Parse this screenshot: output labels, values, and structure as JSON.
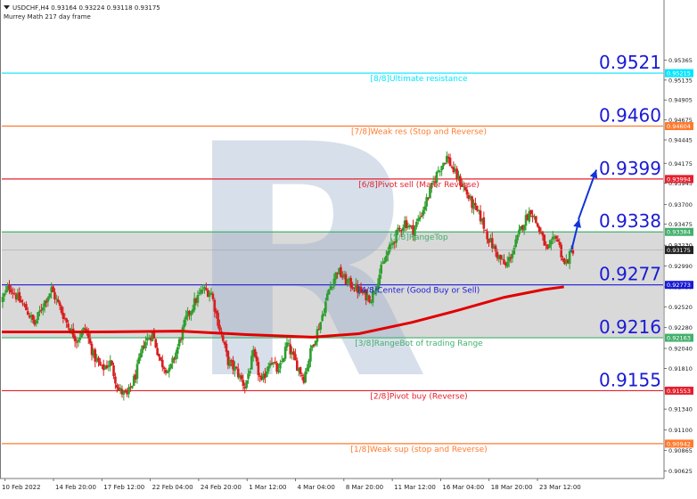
{
  "header": {
    "symbol_line": "USDCHF,H4  0.93164 0.93224 0.93118 0.93175",
    "indicator_line": "Murrey Math 217 day frame"
  },
  "watermark": "R",
  "colors": {
    "background": "#ffffff",
    "candle_bull": "#2e9e2e",
    "candle_bear": "#d81e1e",
    "moving_average": "#e10000",
    "trend_arrow": "#1234d8",
    "range_band": "#d5d5d5"
  },
  "chart_data": {
    "type": "candlestick",
    "symbol": "USDCHF",
    "timeframe": "H4",
    "current_price": 0.93175,
    "y_range": [
      0.9054,
      0.9575
    ],
    "y_ticks": [
      "0.95365",
      "0.95135",
      "0.94905",
      "0.94675",
      "0.94445",
      "0.94175",
      "0.93945",
      "0.93700",
      "0.93475",
      "0.93230",
      "0.92990",
      "0.92750",
      "0.92520",
      "0.92280",
      "0.92040",
      "0.91810",
      "0.91580",
      "0.91340",
      "0.91100",
      "0.90865",
      "0.90625"
    ],
    "x_labels": [
      "10 Feb 2022",
      "14 Feb 20:00",
      "17 Feb 12:00",
      "22 Feb 04:00",
      "24 Feb 20:00",
      "1 Mar 12:00",
      "4 Mar 04:00",
      "8 Mar 20:00",
      "11 Mar 12:00",
      "16 Mar 04:00",
      "18 Mar 20:00",
      "23 Mar 12:00"
    ],
    "current_price_label": "0.93175",
    "levels": [
      {
        "id": "ultimate-resistance",
        "label": "[8/8]Ultimate resistance",
        "price": 0.95215,
        "price_label": "0.95215",
        "big_label": "0.9521",
        "color": "#00e5ff"
      },
      {
        "id": "weak-res",
        "label": "[7/8]Weak res (Stop and Reverse)",
        "price": 0.94604,
        "price_label": "0.94604",
        "big_label": "0.9460",
        "color": "#ff7a2e"
      },
      {
        "id": "pivot-sell",
        "label": "[6/8]Pivot sell (Major Reverse)",
        "price": 0.93994,
        "price_label": "0.93994",
        "big_label": "0.9399",
        "color": "#e4202e"
      },
      {
        "id": "range-top",
        "label": "[5/8]RangeTop",
        "price": 0.93384,
        "price_label": "0.93384",
        "big_label": "0.9338",
        "color": "#43b06c"
      },
      {
        "id": "center",
        "label": "[4/8]Center (Good Buy or Sell)",
        "price": 0.92773,
        "price_label": "0.92773",
        "big_label": "0.9277",
        "color": "#1a1ad6"
      },
      {
        "id": "range-bot",
        "label": "[3/8]RangeBot of trading Range",
        "price": 0.92163,
        "price_label": "0.92163",
        "big_label": "0.9216",
        "color": "#43b06c"
      },
      {
        "id": "pivot-buy",
        "label": "[2/8]Pivot buy (Reverse)",
        "price": 0.91553,
        "price_label": "0.91553",
        "big_label": "0.9155",
        "color": "#e4202e"
      },
      {
        "id": "weak-sup",
        "label": "[1/8]Weak sup (stop and Reverse)",
        "price": 0.90942,
        "price_label": "0.90942",
        "big_label": "",
        "color": "#ff7a2e"
      }
    ],
    "range_band": [
      0.92163,
      0.93384
    ],
    "close_path": [
      0.9258,
      0.9276,
      0.9262,
      0.9249,
      0.9232,
      0.9255,
      0.9272,
      0.9251,
      0.923,
      0.9214,
      0.9227,
      0.9196,
      0.918,
      0.9188,
      0.9156,
      0.9149,
      0.9173,
      0.921,
      0.9221,
      0.9188,
      0.9177,
      0.9205,
      0.9238,
      0.9257,
      0.9272,
      0.9268,
      0.9227,
      0.9189,
      0.9178,
      0.916,
      0.9197,
      0.9163,
      0.9192,
      0.9176,
      0.9209,
      0.9188,
      0.917,
      0.9207,
      0.9235,
      0.9272,
      0.9294,
      0.9282,
      0.9275,
      0.9267,
      0.9262,
      0.929,
      0.9315,
      0.9335,
      0.935,
      0.934,
      0.936,
      0.9385,
      0.941,
      0.9425,
      0.9405,
      0.939,
      0.937,
      0.9355,
      0.933,
      0.9312,
      0.9298,
      0.932,
      0.9347,
      0.9364,
      0.934,
      0.9315,
      0.9335,
      0.93,
      0.9318
    ],
    "moving_average": [
      {
        "x": 0.0,
        "y": 0.9223
      },
      {
        "x": 0.14,
        "y": 0.9223
      },
      {
        "x": 0.27,
        "y": 0.9224
      },
      {
        "x": 0.37,
        "y": 0.922
      },
      {
        "x": 0.47,
        "y": 0.9217
      },
      {
        "x": 0.54,
        "y": 0.9221
      },
      {
        "x": 0.62,
        "y": 0.9234
      },
      {
        "x": 0.69,
        "y": 0.9248
      },
      {
        "x": 0.76,
        "y": 0.9263
      },
      {
        "x": 0.82,
        "y": 0.9272
      },
      {
        "x": 0.85,
        "y": 0.9275
      }
    ],
    "trend_arrows": [
      {
        "from": {
          "x": 0.861,
          "y": 0.9316
        },
        "to": {
          "x": 0.873,
          "y": 0.9353
        }
      },
      {
        "from": {
          "x": 0.872,
          "y": 0.9353
        },
        "to": {
          "x": 0.899,
          "y": 0.941
        }
      }
    ]
  }
}
